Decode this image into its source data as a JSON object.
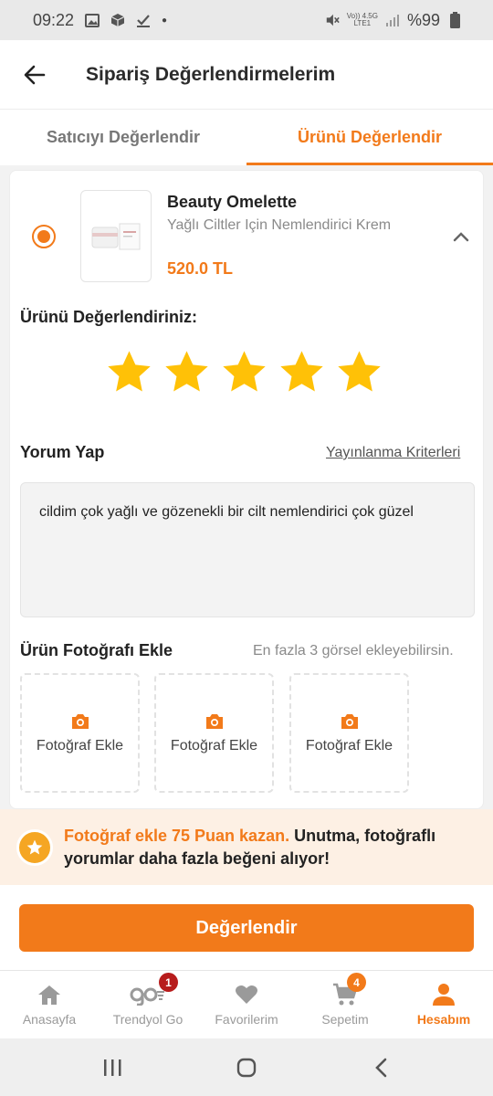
{
  "status_bar": {
    "time": "09:22",
    "network_top": "Vo)) 4.5G",
    "network_bottom": "LTE1",
    "battery": "%99"
  },
  "header": {
    "title": "Sipariş Değerlendirmelerim"
  },
  "tabs": [
    {
      "label": "Satıcıyı Değerlendir",
      "active": false
    },
    {
      "label": "Ürünü Değerlendir",
      "active": true
    }
  ],
  "product": {
    "brand": "Beauty Omelette",
    "name": "Yağlı Ciltler Için Nemlendirici Krem",
    "price": "520.0 TL",
    "selected": true
  },
  "rating": {
    "label": "Ürünü Değerlendiriniz:",
    "value": 5,
    "max": 5,
    "star_color": "#FFC107"
  },
  "review": {
    "label": "Yorum Yap",
    "criteria_link": "Yayınlanma Kriterleri",
    "text": "cildim çok yağlı ve gözenekli bir cilt nemlendirici çok güzel"
  },
  "photos": {
    "label": "Ürün Fotoğrafı Ekle",
    "hint": "En fazla 3 görsel ekleyebilirsin.",
    "slots": [
      {
        "label": "Fotoğraf Ekle"
      },
      {
        "label": "Fotoğraf Ekle"
      },
      {
        "label": "Fotoğraf Ekle"
      }
    ]
  },
  "promo": {
    "highlight": "Fotoğraf ekle 75 Puan kazan.",
    "text": " Unutma, fotoğraflı yorumlar daha fazla beğeni alıyor!"
  },
  "submit_label": "Değerlendir",
  "bottom_nav": [
    {
      "label": "Anasayfa",
      "icon": "home-icon",
      "active": false
    },
    {
      "label": "Trendyol Go",
      "icon": "trendyol-go-icon",
      "badge": "1",
      "active": false
    },
    {
      "label": "Favorilerim",
      "icon": "heart-icon",
      "active": false
    },
    {
      "label": "Sepetim",
      "icon": "cart-icon",
      "badge": "4",
      "active": false
    },
    {
      "label": "Hesabım",
      "icon": "user-icon",
      "active": true
    }
  ],
  "colors": {
    "accent": "#F27A1A",
    "promo_bg": "#FDF0E4",
    "badge_red": "#B71C1C"
  }
}
